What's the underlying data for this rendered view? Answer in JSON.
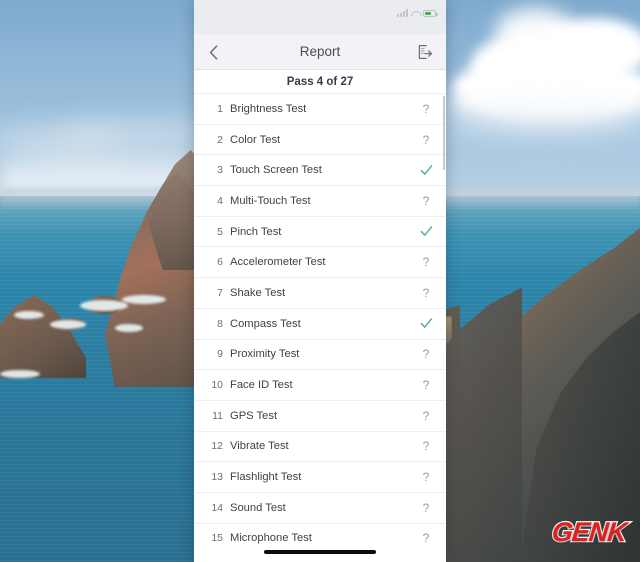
{
  "wallpaper": {
    "description": "coastal cliffs and teal ocean",
    "sky_color": "#9cc0dc",
    "sea_color": "#2b7ea2",
    "rock_color": "#7d6455"
  },
  "statusbar": {
    "time": "",
    "signal_icon": "cellular-signal-icon",
    "wifi_icon": "wifi-icon",
    "battery_icon": "battery-icon",
    "battery_color": "#4cb04c"
  },
  "navbar": {
    "back_icon": "chevron-left-icon",
    "title": "Report",
    "export_icon": "export-icon"
  },
  "summary": {
    "pass_text": "Pass 4 of 27"
  },
  "status_glyphs": {
    "unknown": "?",
    "pass": "✓"
  },
  "colors": {
    "pass_green": "#5fb08a",
    "unknown_grey": "#9a9aa6",
    "navbar_bg": "#f2f2f7",
    "statusbar_bg": "#ebebf2"
  },
  "tests": [
    {
      "num": "1",
      "name": "Brightness Test",
      "status": "unknown"
    },
    {
      "num": "2",
      "name": "Color Test",
      "status": "unknown"
    },
    {
      "num": "3",
      "name": "Touch Screen Test",
      "status": "pass"
    },
    {
      "num": "4",
      "name": "Multi-Touch Test",
      "status": "unknown"
    },
    {
      "num": "5",
      "name": "Pinch Test",
      "status": "pass"
    },
    {
      "num": "6",
      "name": "Accelerometer Test",
      "status": "unknown"
    },
    {
      "num": "7",
      "name": "Shake Test",
      "status": "unknown"
    },
    {
      "num": "8",
      "name": "Compass Test",
      "status": "pass"
    },
    {
      "num": "9",
      "name": "Proximity Test",
      "status": "unknown"
    },
    {
      "num": "10",
      "name": "Face ID Test",
      "status": "unknown"
    },
    {
      "num": "11",
      "name": "GPS Test",
      "status": "unknown"
    },
    {
      "num": "12",
      "name": "Vibrate Test",
      "status": "unknown"
    },
    {
      "num": "13",
      "name": "Flashlight Test",
      "status": "unknown"
    },
    {
      "num": "14",
      "name": "Sound Test",
      "status": "unknown"
    },
    {
      "num": "15",
      "name": "Microphone Test",
      "status": "unknown"
    }
  ],
  "home_indicator": {
    "label": "home-indicator"
  },
  "watermark": {
    "text": "GENK",
    "color": "#e02020"
  }
}
